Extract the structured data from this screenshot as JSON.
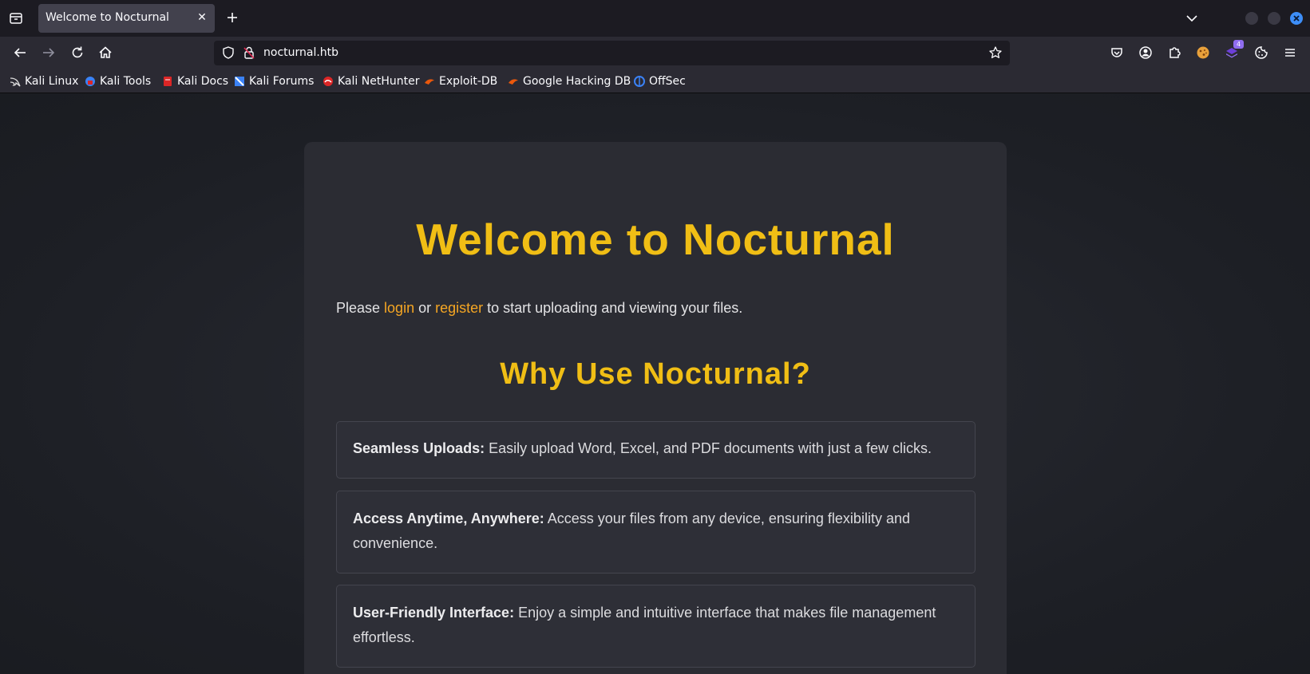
{
  "browser": {
    "tab_title": "Welcome to Nocturnal",
    "tab_close_glyph": "✕",
    "url": "nocturnal.htb",
    "extension_badge": "4",
    "bookmarks": [
      {
        "label": "Kali Linux",
        "icon": "kali-dragon-icon",
        "color": "#dcdcdc"
      },
      {
        "label": "Kali Tools",
        "icon": "kali-tools-icon",
        "color": "#3b82f6"
      },
      {
        "label": "Kali Docs",
        "icon": "kali-docs-icon",
        "color": "#dc2626"
      },
      {
        "label": "Kali Forums",
        "icon": "kali-forums-icon",
        "color": "#3b82f6"
      },
      {
        "label": "Kali NetHunter",
        "icon": "kali-nethunter-icon",
        "color": "#dc2626"
      },
      {
        "label": "Exploit-DB",
        "icon": "exploit-db-icon",
        "color": "#ea580c"
      },
      {
        "label": "Google Hacking DB",
        "icon": "google-hacking-db-icon",
        "color": "#ea580c"
      },
      {
        "label": "OffSec",
        "icon": "offsec-icon",
        "color": "#3b82f6"
      }
    ]
  },
  "page": {
    "hero_title": "Welcome to Nocturnal",
    "intro": {
      "prefix": "Please ",
      "login_link": "login",
      "middle": " or ",
      "register_link": "register",
      "suffix": " to start uploading and viewing your files."
    },
    "why_title": "Why Use Nocturnal?",
    "features": [
      {
        "title": "Seamless Uploads:",
        "text": " Easily upload Word, Excel, and PDF documents with just a few clicks."
      },
      {
        "title": "Access Anytime, Anywhere:",
        "text": " Access your files from any device, ensuring flexibility and convenience."
      },
      {
        "title": "User-Friendly Interface:",
        "text": " Enjoy a simple and intuitive interface that makes file management effortless."
      }
    ]
  },
  "colors": {
    "accent_yellow": "#f0be15",
    "link_orange": "#f5a623",
    "browser_toolbar": "#2b2a33",
    "tab_bar": "#1c1b22"
  }
}
